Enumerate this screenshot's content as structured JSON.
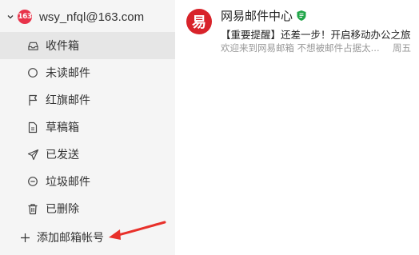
{
  "account": {
    "badge": "163",
    "email": "wsy_nfql@163.com"
  },
  "nav": {
    "items": [
      {
        "label": "收件箱",
        "icon": "inbox-icon",
        "active": true
      },
      {
        "label": "未读邮件",
        "icon": "unread-circle-icon",
        "active": false
      },
      {
        "label": "红旗邮件",
        "icon": "flag-icon",
        "active": false
      },
      {
        "label": "草稿箱",
        "icon": "draft-document-icon",
        "active": false
      },
      {
        "label": "已发送",
        "icon": "send-paper-plane-icon",
        "active": false
      },
      {
        "label": "垃圾邮件",
        "icon": "spam-minus-circle-icon",
        "active": false
      },
      {
        "label": "已删除",
        "icon": "trash-icon",
        "active": false
      }
    ],
    "add_account_label": "添加邮箱帐号"
  },
  "messages": [
    {
      "avatar_glyph": "易",
      "sender": "网易邮件中心",
      "verified_icon": "verified-badge-icon",
      "subject": "【重要提醒】还差一步！开启移动办公之旅",
      "preview": "欢迎来到网易邮箱 不想被邮件占据太...",
      "date": "周五"
    }
  ],
  "colors": {
    "sidebar_bg": "#f5f5f5",
    "active_bg": "#e6e6e6",
    "brand_red": "#d8232a",
    "verified_green": "#21a649",
    "arrow_red": "#e8302a"
  }
}
